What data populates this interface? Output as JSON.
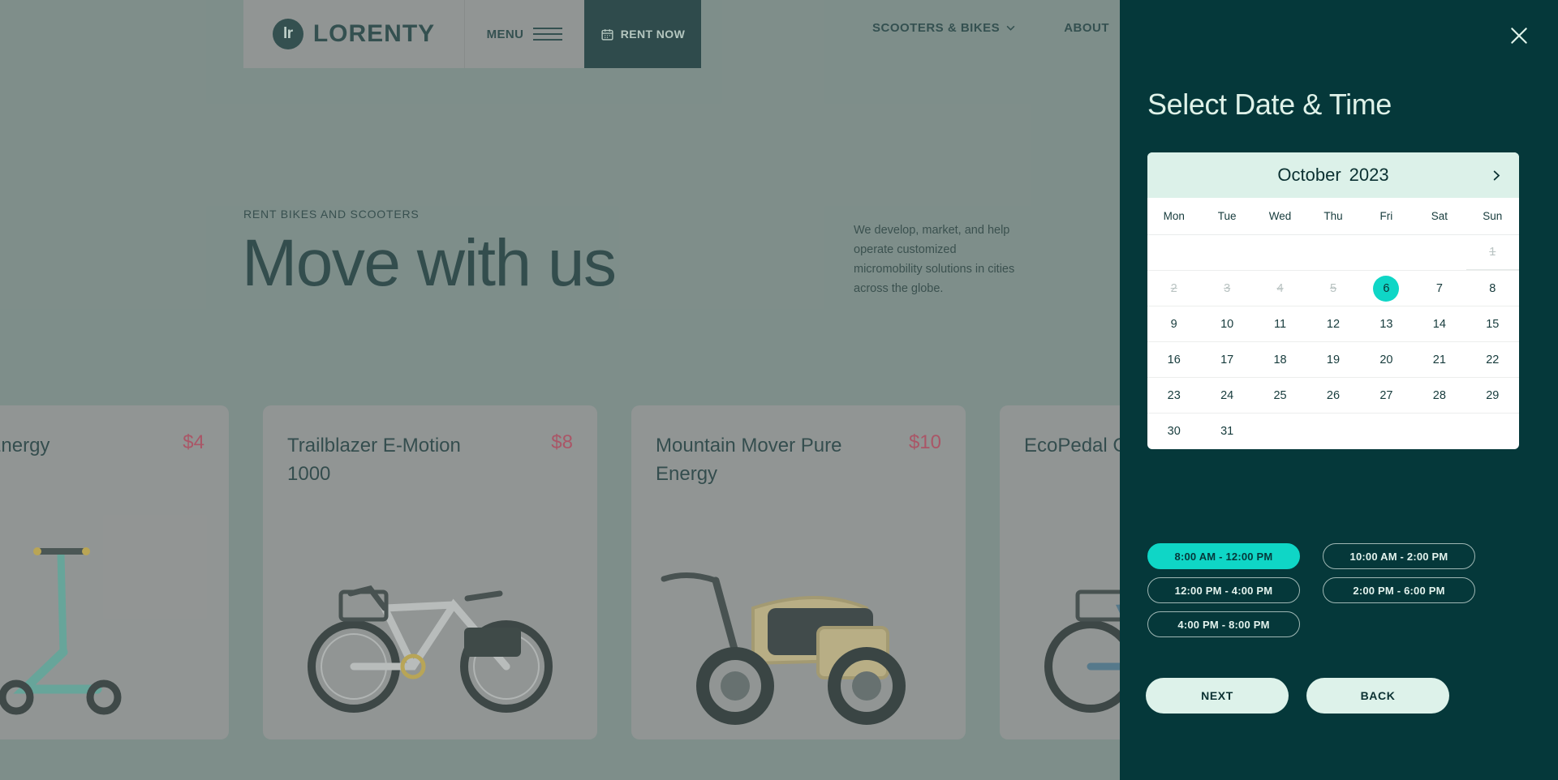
{
  "site": {
    "logo_mark": "lr",
    "logo_text": "LORENTY",
    "menu_label": "MENU",
    "rent_label": "RENT NOW",
    "nav": [
      {
        "label": "SCOOTERS & BIKES",
        "caret": "⌄"
      },
      {
        "label": "ABOUT",
        "caret": ""
      }
    ]
  },
  "hero": {
    "eyebrow": "RENT BIKES AND SCOOTERS",
    "title": "Move with us",
    "description": "We develop, market, and help operate customized micromobility solutions in cities across the globe."
  },
  "products": [
    {
      "title": "er Pure Energy",
      "price": "$4",
      "kind": "scooter"
    },
    {
      "title": "Trailblazer E-Motion 1000",
      "price": "$8",
      "kind": "bike"
    },
    {
      "title": "Mountain Mover Pure Energy",
      "price": "$10",
      "kind": "moped"
    },
    {
      "title": "EcoPedal Cl",
      "price": "",
      "kind": "bike"
    }
  ],
  "panel": {
    "close_icon": "close-icon",
    "title": "Select Date & Time",
    "calendar": {
      "month": "October",
      "year": "2023",
      "next_icon": "chevron-right-icon",
      "day_headers": [
        "Mon",
        "Tue",
        "Wed",
        "Thu",
        "Fri",
        "Sat",
        "Sun"
      ],
      "selected_day": "6",
      "weeks": [
        [
          {
            "d": "",
            "state": "empty"
          },
          {
            "d": "",
            "state": "empty"
          },
          {
            "d": "",
            "state": "empty"
          },
          {
            "d": "",
            "state": "empty"
          },
          {
            "d": "",
            "state": "empty"
          },
          {
            "d": "",
            "state": "empty"
          },
          {
            "d": "1",
            "state": "disabled"
          }
        ],
        [
          {
            "d": "2",
            "state": "disabled"
          },
          {
            "d": "3",
            "state": "disabled"
          },
          {
            "d": "4",
            "state": "disabled"
          },
          {
            "d": "5",
            "state": "disabled"
          },
          {
            "d": "6",
            "state": "selected"
          },
          {
            "d": "7",
            "state": "normal"
          },
          {
            "d": "8",
            "state": "normal"
          }
        ],
        [
          {
            "d": "9",
            "state": "normal"
          },
          {
            "d": "10",
            "state": "normal"
          },
          {
            "d": "11",
            "state": "normal"
          },
          {
            "d": "12",
            "state": "normal"
          },
          {
            "d": "13",
            "state": "normal"
          },
          {
            "d": "14",
            "state": "normal"
          },
          {
            "d": "15",
            "state": "normal"
          }
        ],
        [
          {
            "d": "16",
            "state": "normal"
          },
          {
            "d": "17",
            "state": "normal"
          },
          {
            "d": "18",
            "state": "normal"
          },
          {
            "d": "19",
            "state": "normal"
          },
          {
            "d": "20",
            "state": "normal"
          },
          {
            "d": "21",
            "state": "normal"
          },
          {
            "d": "22",
            "state": "normal"
          }
        ],
        [
          {
            "d": "23",
            "state": "normal"
          },
          {
            "d": "24",
            "state": "normal"
          },
          {
            "d": "25",
            "state": "normal"
          },
          {
            "d": "26",
            "state": "normal"
          },
          {
            "d": "27",
            "state": "normal"
          },
          {
            "d": "28",
            "state": "normal"
          },
          {
            "d": "29",
            "state": "normal"
          }
        ],
        [
          {
            "d": "30",
            "state": "normal"
          },
          {
            "d": "31",
            "state": "normal"
          },
          {
            "d": "",
            "state": "empty"
          },
          {
            "d": "",
            "state": "empty"
          },
          {
            "d": "",
            "state": "empty"
          },
          {
            "d": "",
            "state": "empty"
          },
          {
            "d": "",
            "state": "empty"
          }
        ]
      ]
    },
    "time_slots": [
      {
        "label": "8:00 AM - 12:00 PM",
        "selected": true
      },
      {
        "label": "10:00 AM - 2:00 PM",
        "selected": false
      },
      {
        "label": "12:00 PM - 4:00 PM",
        "selected": false
      },
      {
        "label": "2:00 PM - 6:00 PM",
        "selected": false
      },
      {
        "label": "4:00 PM - 8:00 PM",
        "selected": false
      }
    ],
    "actions": {
      "next": "NEXT",
      "back": "BACK"
    }
  },
  "colors": {
    "panel_bg": "#05383a",
    "accent_teal": "#0fd6c6",
    "mint": "#ddf2ea",
    "price_red": "#c03a55",
    "page_bg": "#7d8f8b",
    "card_bg": "#9a9a9a"
  }
}
